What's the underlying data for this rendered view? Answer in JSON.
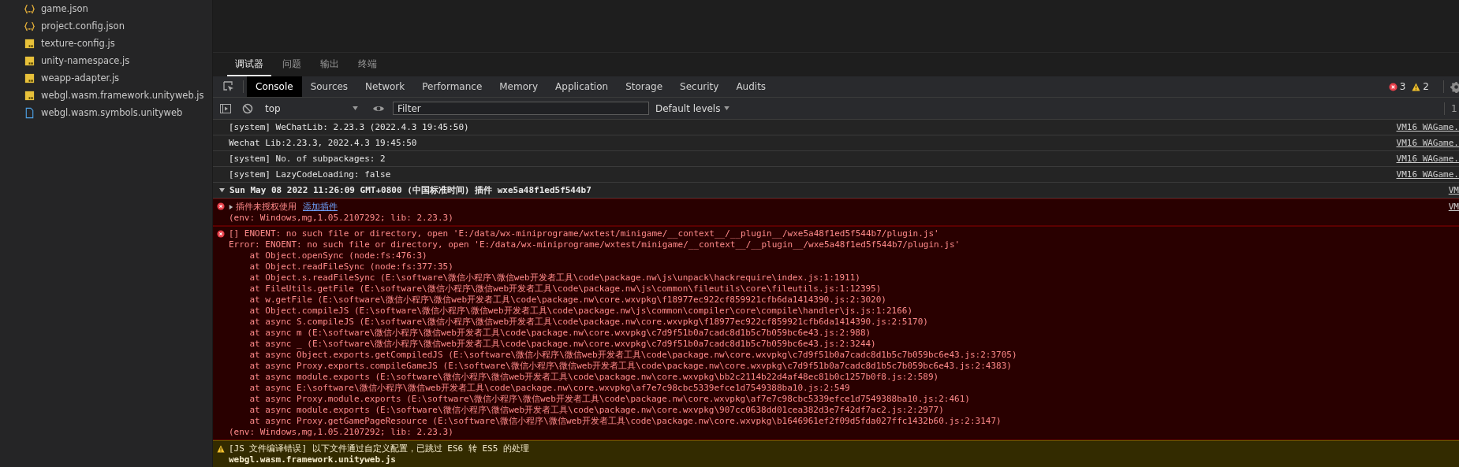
{
  "sidebar": {
    "files": [
      {
        "name": "game.json",
        "kind": "json"
      },
      {
        "name": "project.config.json",
        "kind": "json"
      },
      {
        "name": "texture-config.js",
        "kind": "js"
      },
      {
        "name": "unity-namespace.js",
        "kind": "js"
      },
      {
        "name": "weapp-adapter.js",
        "kind": "js"
      },
      {
        "name": "webgl.wasm.framework.unityweb.js",
        "kind": "js"
      },
      {
        "name": "webgl.wasm.symbols.unityweb",
        "kind": "file"
      }
    ]
  },
  "panel_tabs": [
    {
      "label": "调试器",
      "selected": true
    },
    {
      "label": "问题",
      "selected": false
    },
    {
      "label": "输出",
      "selected": false
    },
    {
      "label": "终端",
      "selected": false
    }
  ],
  "devtools_tabs": [
    {
      "label": "Console",
      "selected": true
    },
    {
      "label": "Sources",
      "selected": false
    },
    {
      "label": "Network",
      "selected": false
    },
    {
      "label": "Performance",
      "selected": false
    },
    {
      "label": "Memory",
      "selected": false
    },
    {
      "label": "Application",
      "selected": false
    },
    {
      "label": "Storage",
      "selected": false
    },
    {
      "label": "Security",
      "selected": false
    },
    {
      "label": "Audits",
      "selected": false
    }
  ],
  "counts": {
    "errors": "3",
    "warnings": "2"
  },
  "toolbar": {
    "context": "top",
    "filter_placeholder": "Filter",
    "levels": "Default levels",
    "hidden_count": "1"
  },
  "messages": [
    {
      "kind": "log",
      "text": "[system] WeChatLib: 2.23.3 (2022.4.3 19:45:50)",
      "source": "VM16 WAGame."
    },
    {
      "kind": "log",
      "text": "Wechat Lib:2.23.3, 2022.4.3 19:45:50",
      "source": "VM16 WAGame."
    },
    {
      "kind": "log",
      "text": "[system] No. of subpackages: 2",
      "source": "VM16 WAGame."
    },
    {
      "kind": "log",
      "text": "[system] LazyCodeLoading: false",
      "source": "VM16 WAGame."
    },
    {
      "kind": "group",
      "text": "Sun May 08 2022 11:26:09 GMT+0800 (中国标准时间) 插件 wxe5a48f1ed5f544b7",
      "source": "VM",
      "expanded": true
    },
    {
      "kind": "error",
      "text": "插件未授权使用",
      "link": "添加插件",
      "expanded": false,
      "source": "VM",
      "footer": "(env: Windows,mg,1.05.2107292; lib: 2.23.3)"
    },
    {
      "kind": "error",
      "text": "[] ENOENT: no such file or directory, open 'E:/data/wx-miniprograme/wxtest/minigame/__context__/__plugin__/wxe5a48f1ed5f544b7/plugin.js'",
      "stack": [
        "Error: ENOENT: no such file or directory, open 'E:/data/wx-miniprograme/wxtest/minigame/__context__/__plugin__/wxe5a48f1ed5f544b7/plugin.js'",
        "    at Object.openSync (node:fs:476:3)",
        "    at Object.readFileSync (node:fs:377:35)",
        "    at Object.s.readFileSync (E:\\software\\微信小程序\\微信web开发者工具\\code\\package.nw\\js\\unpack\\hackrequire\\index.js:1:1911)",
        "    at FileUtils.getFile (E:\\software\\微信小程序\\微信web开发者工具\\code\\package.nw\\js\\common\\fileutils\\core\\fileutils.js:1:12395)",
        "    at w.getFile (E:\\software\\微信小程序\\微信web开发者工具\\code\\package.nw\\core.wxvpkg\\f18977ec922cf859921cfb6da1414390.js:2:3020)",
        "    at Object.compileJS (E:\\software\\微信小程序\\微信web开发者工具\\code\\package.nw\\js\\common\\compiler\\core\\compile\\handler\\js.js:1:2166)",
        "    at async S.compileJS (E:\\software\\微信小程序\\微信web开发者工具\\code\\package.nw\\core.wxvpkg\\f18977ec922cf859921cfb6da1414390.js:2:5170)",
        "    at async m (E:\\software\\微信小程序\\微信web开发者工具\\code\\package.nw\\core.wxvpkg\\c7d9f51b0a7cadc8d1b5c7b059bc6e43.js:2:988)",
        "    at async _ (E:\\software\\微信小程序\\微信web开发者工具\\code\\package.nw\\core.wxvpkg\\c7d9f51b0a7cadc8d1b5c7b059bc6e43.js:2:3244)",
        "    at async Object.exports.getCompiledJS (E:\\software\\微信小程序\\微信web开发者工具\\code\\package.nw\\core.wxvpkg\\c7d9f51b0a7cadc8d1b5c7b059bc6e43.js:2:3705)",
        "    at async Proxy.exports.compileGameJS (E:\\software\\微信小程序\\微信web开发者工具\\code\\package.nw\\core.wxvpkg\\c7d9f51b0a7cadc8d1b5c7b059bc6e43.js:2:4383)",
        "    at async module.exports (E:\\software\\微信小程序\\微信web开发者工具\\code\\package.nw\\core.wxvpkg\\bb2c2114b22d4af48ec81b0c1257b0f8.js:2:589)",
        "    at async E:\\software\\微信小程序\\微信web开发者工具\\code\\package.nw\\core.wxvpkg\\af7e7c98cbc5339efce1d7549388ba10.js:2:549",
        "    at async Proxy.module.exports (E:\\software\\微信小程序\\微信web开发者工具\\code\\package.nw\\core.wxvpkg\\af7e7c98cbc5339efce1d7549388ba10.js:2:461)",
        "    at async module.exports (E:\\software\\微信小程序\\微信web开发者工具\\code\\package.nw\\core.wxvpkg\\907cc0638dd01cea382d3e7f42df7ac2.js:2:2977)",
        "    at async Proxy.getGamePageResource (E:\\software\\微信小程序\\微信web开发者工具\\code\\package.nw\\core.wxvpkg\\b1646961ef2f09d5fda027ffc1432b60.js:2:3147)"
      ],
      "footer": "(env: Windows,mg,1.05.2107292; lib: 2.23.3)"
    },
    {
      "kind": "warning",
      "text": "[JS 文件编译错误] 以下文件通过自定义配置，已跳过 ES6 转 ES5 的处理",
      "detail": "webgl.wasm.framework.unityweb.js"
    }
  ]
}
